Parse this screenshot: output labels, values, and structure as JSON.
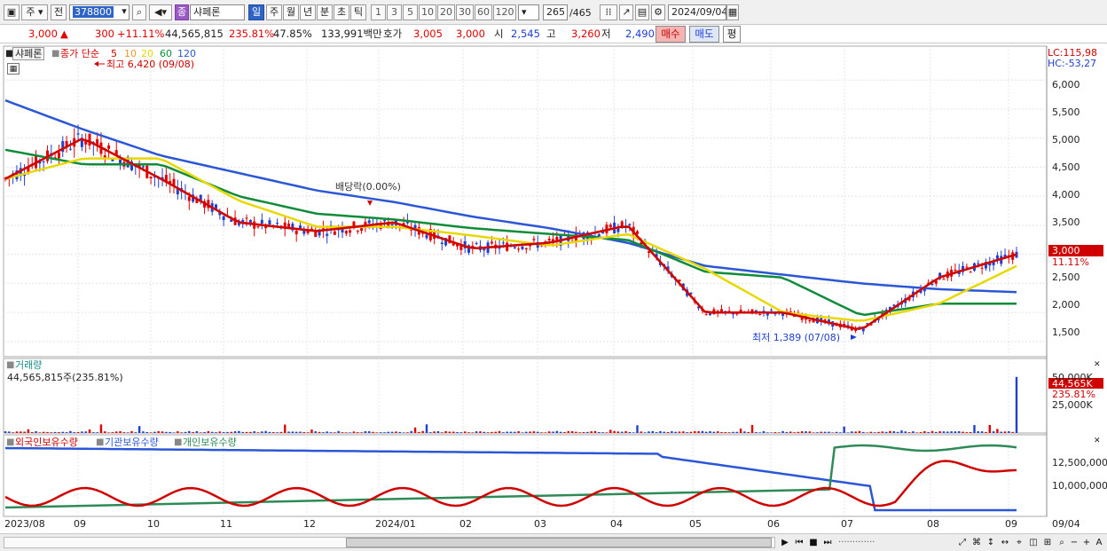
{
  "toolbar": {
    "period_label": "주",
    "prev_label": "전",
    "code": "378800",
    "tag": "종",
    "stock_name": "샤페론",
    "periods": [
      "일",
      "주",
      "월",
      "년",
      "분",
      "초",
      "틱"
    ],
    "intervals": [
      "1",
      "3",
      "5",
      "10",
      "20",
      "30",
      "60",
      "120"
    ],
    "count": "265",
    "total": "/465",
    "date": "2024/09/04"
  },
  "quote": {
    "price": "3,000",
    "arrow": "▲",
    "change": "300",
    "change_pct": "+11.11%",
    "volume": "44,565,815",
    "vol_ratio": "235.81%",
    "turnover": "47.85%",
    "amount": "133,991백만",
    "hoga_label": "호가",
    "hoga1": "3,005",
    "hoga2": "3,000",
    "open_label": "시",
    "open": "2,545",
    "high_label": "고",
    "high": "3,260",
    "low_label": "저",
    "low": "2,490",
    "buy": "매수",
    "sell": "매도",
    "avg": "평"
  },
  "price_pane": {
    "stock_tag": "샤페론",
    "ma_title": "종가 단순",
    "ma_periods": [
      "5",
      "10",
      "20",
      "60",
      "120"
    ],
    "ma_colors": [
      "#d00000",
      "#e39a2a",
      "#e8d800",
      "#0f8c3a",
      "#2b57d6"
    ],
    "max_note": "최고 6,420 (09/08)",
    "min_note": "최저 1,389 (07/08)",
    "div_note": "배당락(0.00%)",
    "lc": "LC:115,98",
    "hc": "HC:-53,27",
    "yticks": [
      "6,000",
      "5,500",
      "5,000",
      "4,500",
      "4,000",
      "3,500",
      "3,000",
      "2,500",
      "2,000",
      "1,500"
    ],
    "cur_price": "3,000",
    "cur_pct": "11.11%"
  },
  "volume_pane": {
    "title": "거래량",
    "value": "44,565,815주(235.81%)",
    "yticks": [
      "50,000K",
      "25,000K"
    ],
    "cur": "44,565K",
    "cur_pct": "235.81%"
  },
  "holders_pane": {
    "items": [
      "외국인보유수량",
      "기관보유수량",
      "개인보유수량"
    ],
    "colors": [
      "#d00000",
      "#2b57d6",
      "#2e8b57"
    ],
    "yticks": [
      "12,500,000",
      "10,000,000"
    ]
  },
  "xaxis": [
    "2023/08",
    "09",
    "10",
    "11",
    "12",
    "2024/01",
    "02",
    "03",
    "04",
    "05",
    "06",
    "07",
    "08",
    "09",
    "09/04"
  ],
  "chart_data": {
    "type": "line",
    "title": "샤페론",
    "price_series": {
      "name": "종가 단순 5",
      "x": [
        "2023/08",
        "09",
        "10",
        "11",
        "12",
        "2024/01",
        "02",
        "03",
        "04",
        "05",
        "06",
        "07",
        "08",
        "09"
      ],
      "values": [
        4300,
        5000,
        4300,
        3550,
        3400,
        3550,
        3100,
        3200,
        3500,
        2000,
        2000,
        1700,
        2600,
        3000
      ]
    },
    "ma120": {
      "name": "120",
      "values": [
        5650,
        5150,
        4700,
        4400,
        4100,
        3900,
        3650,
        3450,
        3200,
        2800,
        2650,
        2500,
        2400,
        2350
      ]
    },
    "ma60": {
      "name": "60",
      "values": [
        4800,
        4550,
        4550,
        4000,
        3700,
        3600,
        3450,
        3350,
        3250,
        2700,
        2600,
        1950,
        2150,
        2150
      ]
    },
    "ylim": [
      1300,
      6400
    ],
    "volume_ylim": [
      0,
      55000000
    ],
    "volume_last": 44565815
  }
}
